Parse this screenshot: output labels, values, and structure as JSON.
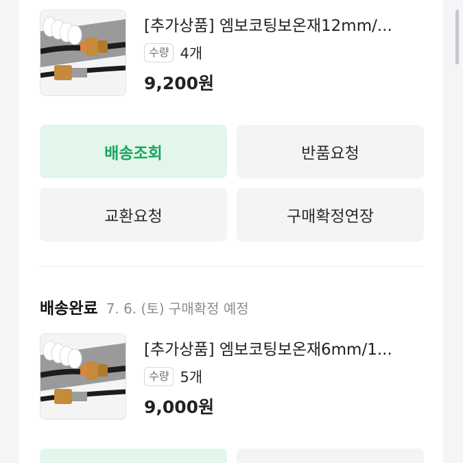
{
  "items": [
    {
      "title": "[추가상품] 엠보코팅보온재12mm/...",
      "qty_label": "수량",
      "qty_value": "4개",
      "price": "9,200원"
    },
    {
      "title": "[추가상품] 엠보코팅보온재6mm/1...",
      "qty_label": "수량",
      "qty_value": "5개",
      "price": "9,000원"
    }
  ],
  "actions": {
    "track_delivery": "배송조회",
    "return_request": "반품요청",
    "exchange_request": "교환요청",
    "extend_confirmation": "구매확정연장"
  },
  "order_status": {
    "label": "배송완료",
    "note": "7. 6. (토) 구매확정 예정"
  },
  "colors": {
    "primary_button_bg": "#e3f6ec",
    "primary_button_text": "#19a559",
    "secondary_button_bg": "#f3f4f6"
  }
}
